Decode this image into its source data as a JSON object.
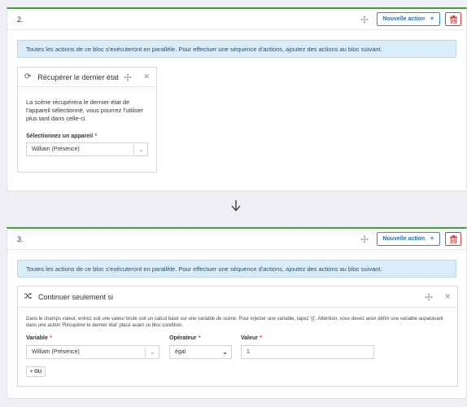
{
  "block2": {
    "number": "2.",
    "new_action_label": "Nouvelle action",
    "info": "Toutes les actions de ce bloc s'exécuteront en parallèle. Pour effectuer une séquence d'actions, ajoutez des actions au bloc suivant.",
    "card": {
      "title": "Récupérer le dernier état",
      "description": "La scène récupèrera le dernier état de l'appareil sélectionné, vous pourrez l'utiliser plus tard dans celle-ci.",
      "device_label": "Sélectionnez un appareil",
      "device_value": "William (Présence)"
    }
  },
  "block3": {
    "number": "3.",
    "new_action_label": "Nouvelle action",
    "info": "Toutes les actions de ce bloc s'exécuteront en parallèle. Pour effectuer une séquence d'actions, ajoutez des actions au bloc suivant.",
    "card": {
      "title": "Continuer seulement si",
      "description": "Dans le champs valeur, entrez soit une valeur brute soit un calcul basé sur une variable de scène. Pour injecter une variable, tapez '{{'. Attention, vous devez avoir défini une variable auparavant dans une action 'Récupérer le dernier état' placé avant ce bloc condition.",
      "variable_label": "Variable",
      "variable_value": "William (Présence)",
      "operator_label": "Opérateur",
      "operator_value": "égal",
      "value_label": "Valeur",
      "value_value": "1",
      "or_button": "+ OU"
    }
  },
  "required_mark": "*",
  "icons": {
    "move": "move-icon",
    "plus": "plus-icon",
    "trash": "trash-icon",
    "refresh": "refresh-icon",
    "shuffle": "shuffle-icon",
    "close": "close-icon",
    "chevron": "chevron-down-icon",
    "arrow": "arrow-down-icon"
  },
  "colors": {
    "accent_green": "#3aa335",
    "primary_blue": "#2a6fb0",
    "danger_red": "#d23c3c",
    "info_bg": "#d9ecf8"
  }
}
